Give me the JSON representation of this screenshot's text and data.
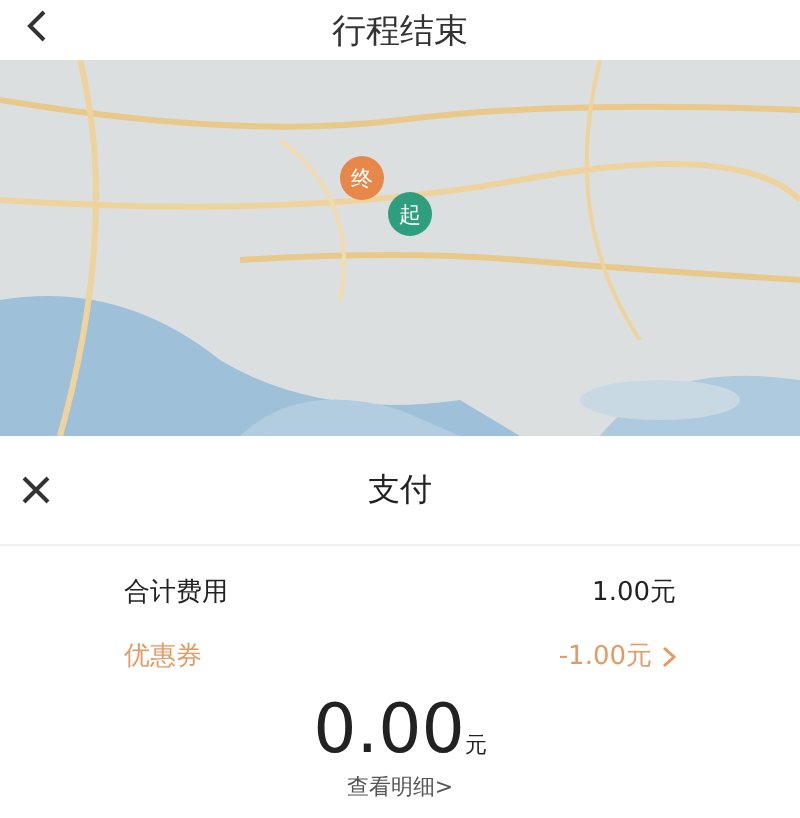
{
  "header": {
    "title": "行程结束"
  },
  "map": {
    "kind": "picture",
    "markers": [
      {
        "label": "终",
        "color": "#e8874a"
      },
      {
        "label": "起",
        "color": "#2f9e7e"
      }
    ]
  },
  "payment": {
    "title": "支付",
    "rows": [
      {
        "label": "合计费用",
        "value": "1.00元",
        "kind": "plain"
      },
      {
        "label": "优惠券",
        "value": "-1.00元",
        "kind": "coupon"
      }
    ],
    "amount": "0.00",
    "unit": "元",
    "details_link": "查看明细>"
  }
}
